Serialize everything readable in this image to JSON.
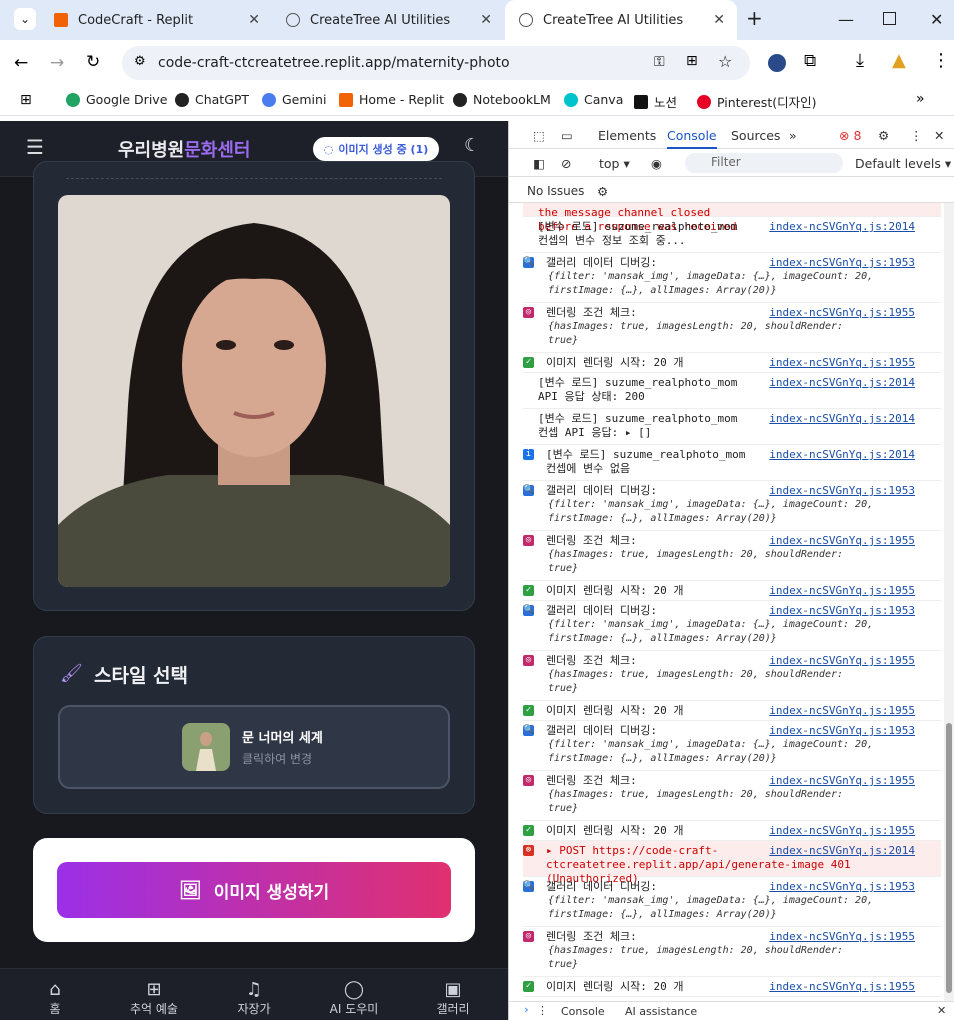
{
  "tabs": [
    {
      "title": "CodeCraft - Replit"
    },
    {
      "title": "CreateTree AI Utilities"
    },
    {
      "title": "CreateTree AI Utilities"
    }
  ],
  "address": {
    "url": "code-craft-ctcreatetree.replit.app/maternity-photo"
  },
  "bookmarks": [
    "Google Drive",
    "ChatGPT",
    "Gemini",
    "Home - Replit",
    "NotebookLM",
    "Canva",
    "노션",
    "Pinterest(디자인)"
  ],
  "app": {
    "brand_a": "우리병원",
    "brand_b": "문화센터",
    "badge": "이미지 생성 중 (1)",
    "style_title": "스타일 선택",
    "style_name": "문 너머의 세계",
    "style_hint": "클릭하여 변경",
    "generate": "이미지 생성하기",
    "nav": [
      "홈",
      "추억 예술",
      "자장가",
      "AI 도우미",
      "갤러리"
    ]
  },
  "devtools": {
    "tabs": [
      "Elements",
      "Console",
      "Sources"
    ],
    "error_count": "8",
    "context": "top",
    "filter": "Filter",
    "levels": "Default levels",
    "issues": "No Issues",
    "footer": [
      "Console",
      "AI assistance"
    ],
    "log": [
      {
        "t": "the message channel closed before a response was received",
        "s": "",
        "k": "err-line"
      },
      {
        "t": "[변수 로드] suzume_realphoto_mom 컨셉의 변수 정보 조회 중...",
        "s": "index-ncSVGnYq.js:2014",
        "k": "plain"
      },
      {
        "t": "갤러리 데이터 디버깅:",
        "o": "{filter: 'mansak_img', imageData: {…}, imageCount: 20, firstImage: {…}, allImages: Array(20)}",
        "s": "index-ncSVGnYq.js:1953",
        "k": "search"
      },
      {
        "t": "렌더링 조건 체크:",
        "o": "{hasImages: true, imagesLength: 20, shouldRender: true}",
        "s": "index-ncSVGnYq.js:1955",
        "k": "target"
      },
      {
        "t": "이미지 렌더링 시작: 20 개",
        "s": "index-ncSVGnYq.js:1955",
        "k": "check"
      },
      {
        "t": "[변수 로드] suzume_realphoto_mom API 응답 상태: 200",
        "s": "index-ncSVGnYq.js:2014",
        "k": "plain"
      },
      {
        "t": "[변수 로드] suzume_realphoto_mom 컨셉 API 응답: ▸ []",
        "s": "index-ncSVGnYq.js:2014",
        "k": "plain"
      },
      {
        "t": "[변수 로드] suzume_realphoto_mom 컨셉에 변수 없음",
        "s": "index-ncSVGnYq.js:2014",
        "k": "info"
      },
      {
        "t": "갤러리 데이터 디버깅:",
        "o": "{filter: 'mansak_img', imageData: {…}, imageCount: 20, firstImage: {…}, allImages: Array(20)}",
        "s": "index-ncSVGnYq.js:1953",
        "k": "search"
      },
      {
        "t": "렌더링 조건 체크:",
        "o": "{hasImages: true, imagesLength: 20, shouldRender: true}",
        "s": "index-ncSVGnYq.js:1955",
        "k": "target"
      },
      {
        "t": "이미지 렌더링 시작: 20 개",
        "s": "index-ncSVGnYq.js:1955",
        "k": "check"
      },
      {
        "t": "갤러리 데이터 디버깅:",
        "o": "{filter: 'mansak_img', imageData: {…}, imageCount: 20, firstImage: {…}, allImages: Array(20)}",
        "s": "index-ncSVGnYq.js:1953",
        "k": "search"
      },
      {
        "t": "렌더링 조건 체크:",
        "o": "{hasImages: true, imagesLength: 20, shouldRender: true}",
        "s": "index-ncSVGnYq.js:1955",
        "k": "target"
      },
      {
        "t": "이미지 렌더링 시작: 20 개",
        "s": "index-ncSVGnYq.js:1955",
        "k": "check"
      },
      {
        "t": "갤러리 데이터 디버깅:",
        "o": "{filter: 'mansak_img', imageData: {…}, imageCount: 20, firstImage: {…}, allImages: Array(20)}",
        "s": "index-ncSVGnYq.js:1953",
        "k": "search"
      },
      {
        "t": "렌더링 조건 체크:",
        "o": "{hasImages: true, imagesLength: 20, shouldRender: true}",
        "s": "index-ncSVGnYq.js:1955",
        "k": "target"
      },
      {
        "t": "이미지 렌더링 시작: 20 개",
        "s": "index-ncSVGnYq.js:1955",
        "k": "check"
      },
      {
        "t": "▸ POST https://code-craft-ctcreatetree.replit.app/api/generate-image 401 (Unauthorized)",
        "s": "index-ncSVGnYq.js:2014",
        "k": "err"
      },
      {
        "t": "갤러리 데이터 디버깅:",
        "o": "{filter: 'mansak_img', imageData: {…}, imageCount: 20, firstImage: {…}, allImages: Array(20)}",
        "s": "index-ncSVGnYq.js:1953",
        "k": "search"
      },
      {
        "t": "렌더링 조건 체크:",
        "o": "{hasImages: true, imagesLength: 20, shouldRender: true}",
        "s": "index-ncSVGnYq.js:1955",
        "k": "target"
      },
      {
        "t": "이미지 렌더링 시작: 20 개",
        "s": "index-ncSVGnYq.js:1955",
        "k": "check"
      }
    ]
  }
}
